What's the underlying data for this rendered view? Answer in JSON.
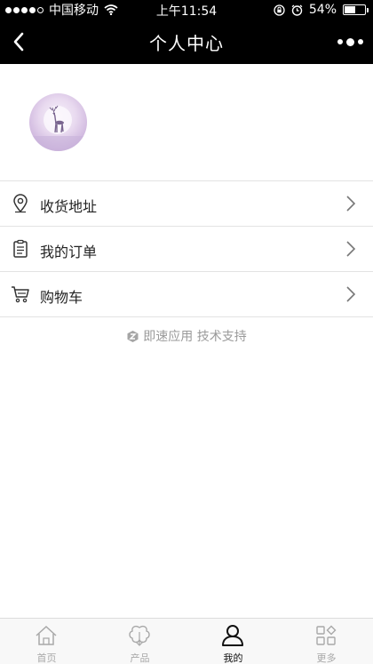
{
  "status_bar": {
    "carrier": "中国移动",
    "time": "上午11:54",
    "battery": "54%",
    "battery_level": 0.54,
    "icons": [
      "signal-dots-icon",
      "wifi-icon",
      "rotation-lock-icon",
      "alarm-icon",
      "battery-icon"
    ]
  },
  "nav": {
    "title": "个人中心",
    "back_icon": "chevron-left-icon",
    "more_icon": "more-dots-icon"
  },
  "profile": {
    "avatar_icon": "deer-avatar"
  },
  "menu": [
    {
      "label": "收货地址",
      "icon": "location-pin-icon"
    },
    {
      "label": "我的订单",
      "icon": "clipboard-icon"
    },
    {
      "label": "购物车",
      "icon": "cart-icon"
    }
  ],
  "credit": {
    "text": "即速应用 技术支持",
    "icon": "jisu-logo-icon"
  },
  "tabs": [
    {
      "label": "首页",
      "icon": "home-icon",
      "active": false
    },
    {
      "label": "产品",
      "icon": "cotton-icon",
      "active": false
    },
    {
      "label": "我的",
      "icon": "user-icon",
      "active": true
    },
    {
      "label": "更多",
      "icon": "grid-icon",
      "active": false
    }
  ],
  "colors": {
    "header_bg": "#000000",
    "active_tab": "#111111",
    "inactive_tab": "#a8a8a8"
  }
}
